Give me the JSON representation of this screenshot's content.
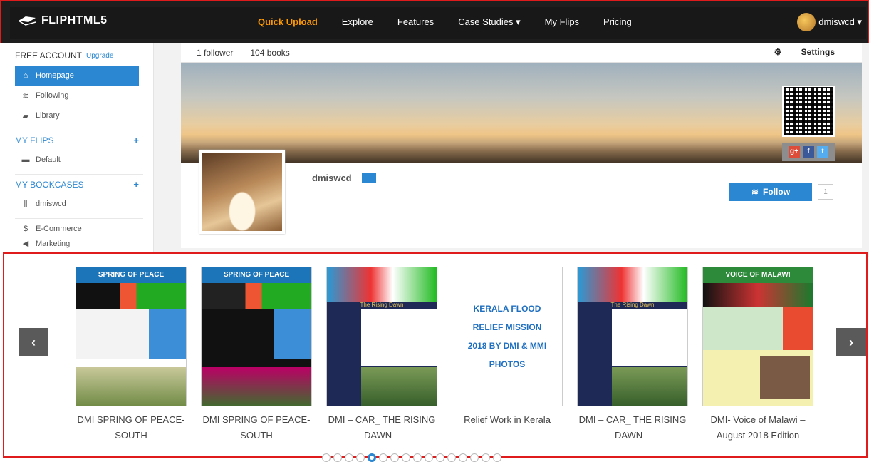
{
  "topnav": {
    "logo": "FLIPHTML5",
    "items": [
      "Quick Upload",
      "Explore",
      "Features",
      "Case Studies ▾",
      "My Flips",
      "Pricing"
    ],
    "user": "dmiswcd ▾"
  },
  "sidebar": {
    "account": "FREE ACCOUNT",
    "upgrade": "Upgrade",
    "items": [
      "Homepage",
      "Following",
      "Library"
    ],
    "myflips": "MY FLIPS",
    "flips": [
      "Default"
    ],
    "bookcases": "MY BOOKCASES",
    "cases": [
      "dmiswcd"
    ],
    "extra": [
      "E-Commerce",
      "Marketing"
    ]
  },
  "stats": {
    "followers": "1 follower",
    "books": "104 books",
    "settings": "Settings"
  },
  "profile": {
    "name": "dmiswcd",
    "follow": "Follow",
    "follow_count": "1"
  },
  "books": [
    {
      "title": "DMI SPRING OF PEACE- SOUTH",
      "cover_title": "SPRING OF PEACE"
    },
    {
      "title": "DMI SPRING OF PEACE- SOUTH",
      "cover_title": "SPRING OF PEACE"
    },
    {
      "title": "DMI – CAR_ THE RISING DAWN –",
      "cover_title": "The Rising Dawn"
    },
    {
      "title": "Relief Work in Kerala",
      "cover_title": "KERALA FLOOD RELIEF MISSION 2018 BY DMI & MMI PHOTOS"
    },
    {
      "title": "DMI – CAR_ THE RISING DAWN –",
      "cover_title": "The Rising Dawn"
    },
    {
      "title": "DMI- Voice of Malawi – August 2018 Edition",
      "cover_title": "VOICE OF MALAWI"
    }
  ],
  "carousel": {
    "dot_count": 16,
    "active_dot": 4
  }
}
